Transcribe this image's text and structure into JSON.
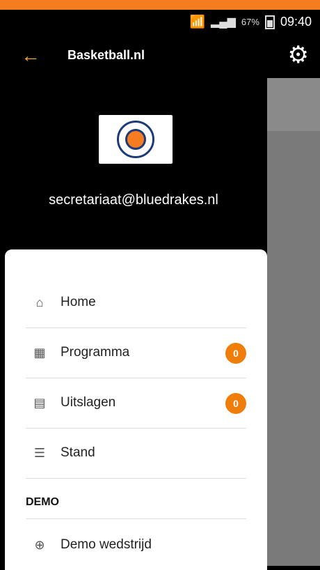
{
  "status": {
    "battery": "67%",
    "time": "09:40"
  },
  "app_bar": {
    "title": "Basketball.nl",
    "back_icon": "arrow-left-icon",
    "settings_icon": "gear-icon"
  },
  "drawer": {
    "email": "secretariaat@bluedrakes.nl",
    "logo": "team-logo",
    "items": [
      {
        "label": "Home",
        "icon": "home-icon",
        "badge": null
      },
      {
        "label": "Programma",
        "icon": "calendar-icon",
        "badge": "0"
      },
      {
        "label": "Uitslagen",
        "icon": "scoreboard-icon",
        "badge": "0"
      },
      {
        "label": "Stand",
        "icon": "list-icon",
        "badge": null
      }
    ],
    "section": {
      "title": "DEMO",
      "items": [
        {
          "label": "Demo wedstrijd",
          "icon": "plus-circle-icon"
        }
      ]
    }
  },
  "colors": {
    "accent": "#f57c20",
    "badge": "#ef7d0a",
    "back_icon": "#f5a623"
  }
}
